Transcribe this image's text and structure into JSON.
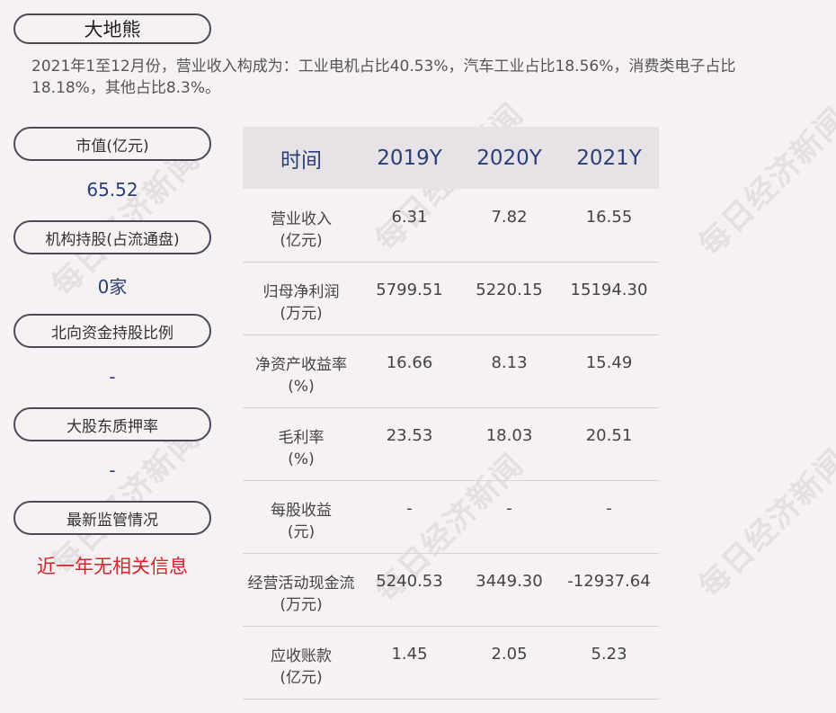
{
  "company": "大地熊",
  "summary": "2021年1至12月份，营业收入构成为：工业电机占比40.53%，汽车工业占比18.56%，消费类电子占比18.18%，其他占比8.3%。",
  "watermark": "每日经济新闻",
  "metrics": [
    {
      "label": "市值(亿元)",
      "value": "65.52"
    },
    {
      "label": "机构持股(占流通盘)",
      "value": "0家"
    },
    {
      "label": "北向资金持股比例",
      "value": "-"
    },
    {
      "label": "大股东质押率",
      "value": "-"
    },
    {
      "label": "最新监管情况",
      "value": "近一年无相关信息"
    }
  ],
  "table": {
    "headers": [
      "时间",
      "2019Y",
      "2020Y",
      "2021Y"
    ],
    "rows": [
      {
        "label1": "营业收入",
        "label2": "(亿元)",
        "values": [
          "6.31",
          "7.82",
          "16.55"
        ]
      },
      {
        "label1": "归母净利润",
        "label2": "(万元)",
        "values": [
          "5799.51",
          "5220.15",
          "15194.30"
        ]
      },
      {
        "label1": "净资产收益率",
        "label2": "(%)",
        "values": [
          "16.66",
          "8.13",
          "15.49"
        ]
      },
      {
        "label1": "毛利率",
        "label2": "(%)",
        "values": [
          "23.53",
          "18.03",
          "20.51"
        ]
      },
      {
        "label1": "每股收益",
        "label2": "(元)",
        "values": [
          "-",
          "-",
          "-"
        ]
      },
      {
        "label1": "经营活动现金流",
        "label2": "(万元)",
        "values": [
          "5240.53",
          "3449.30",
          "-12937.64"
        ]
      },
      {
        "label1": "应收账款",
        "label2": "(亿元)",
        "values": [
          "1.45",
          "2.05",
          "5.23"
        ]
      }
    ]
  },
  "colors": {
    "background": "#f6f1f3",
    "header_text": "#2a3f7a",
    "alert_text": "#d4232a"
  }
}
